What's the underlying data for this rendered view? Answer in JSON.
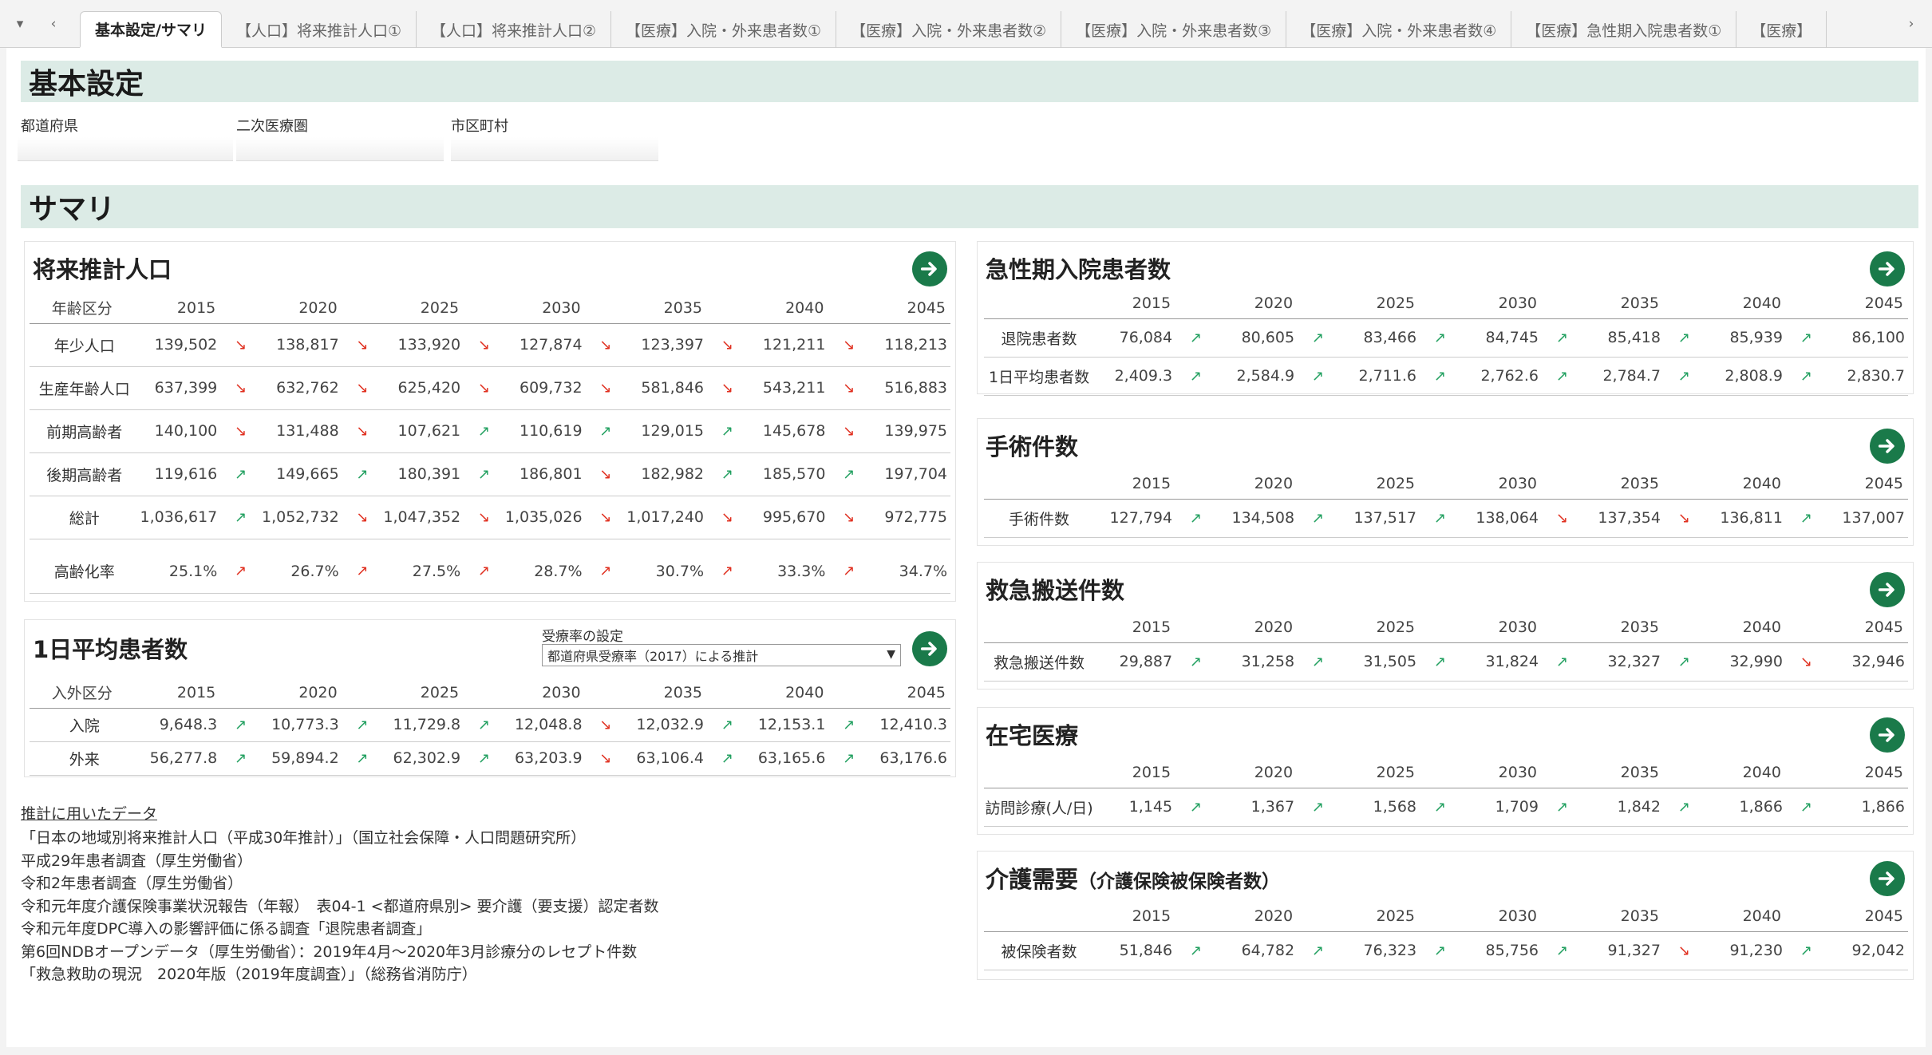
{
  "tabs": [
    "基本設定/サマリ",
    "【人口】将来推計人口①",
    "【人口】将来推計人口②",
    "【医療】入院・外来患者数①",
    "【医療】入院・外来患者数②",
    "【医療】入院・外来患者数③",
    "【医療】入院・外来患者数④",
    "【医療】急性期入院患者数①",
    "【医療】"
  ],
  "kihon": {
    "title": "基本設定",
    "prefecture_label": "都道府県",
    "area_label": "二次医療圏",
    "city_label": "市区町村"
  },
  "summary_title": "サマリ",
  "years": [
    "2015",
    "2020",
    "2025",
    "2030",
    "2035",
    "2040",
    "2045"
  ],
  "population": {
    "title": "将来推計人口",
    "header_label": "年齢区分",
    "rows": [
      {
        "label": "年少人口",
        "values": [
          "139,502",
          "138,817",
          "133,920",
          "127,874",
          "123,397",
          "121,211",
          "118,213"
        ],
        "trend": [
          "down",
          "down",
          "down",
          "down",
          "down",
          "down"
        ]
      },
      {
        "label": "生産年齢人口",
        "values": [
          "637,399",
          "632,762",
          "625,420",
          "609,732",
          "581,846",
          "543,211",
          "516,883"
        ],
        "trend": [
          "down",
          "down",
          "down",
          "down",
          "down",
          "down"
        ]
      },
      {
        "label": "前期高齢者",
        "values": [
          "140,100",
          "131,488",
          "107,621",
          "110,619",
          "129,015",
          "145,678",
          "139,975"
        ],
        "trend": [
          "down",
          "down",
          "up",
          "up",
          "up",
          "down"
        ]
      },
      {
        "label": "後期高齢者",
        "values": [
          "119,616",
          "149,665",
          "180,391",
          "186,801",
          "182,982",
          "185,570",
          "197,704"
        ],
        "trend": [
          "up",
          "up",
          "up",
          "down",
          "up",
          "up"
        ]
      },
      {
        "label": "総計",
        "values": [
          "1,036,617",
          "1,052,732",
          "1,047,352",
          "1,035,026",
          "1,017,240",
          "995,670",
          "972,775"
        ],
        "trend": [
          "up",
          "down",
          "down",
          "down",
          "down",
          "down"
        ]
      }
    ],
    "aging": {
      "label": "高齢化率",
      "values": [
        "25.1%",
        "26.7%",
        "27.5%",
        "28.7%",
        "30.7%",
        "33.3%",
        "34.7%"
      ],
      "trend": [
        "up",
        "up",
        "up",
        "up",
        "up",
        "up"
      ]
    }
  },
  "daily": {
    "title": "1日平均患者数",
    "header_label": "入外区分",
    "setting_label": "受療率の設定",
    "setting_value": "都道府県受療率（2017）による推計",
    "rows": [
      {
        "label": "入院",
        "values": [
          "9,648.3",
          "10,773.3",
          "11,729.8",
          "12,048.8",
          "12,032.9",
          "12,153.1",
          "12,410.3"
        ],
        "trend": [
          "up",
          "up",
          "up",
          "down",
          "up",
          "up"
        ]
      },
      {
        "label": "外来",
        "values": [
          "56,277.8",
          "59,894.2",
          "62,302.9",
          "63,203.9",
          "63,106.4",
          "63,165.6",
          "63,176.6"
        ],
        "trend": [
          "up",
          "up",
          "up",
          "down",
          "up",
          "up"
        ]
      }
    ]
  },
  "notes": {
    "title": "推計に用いたデータ",
    "lines": [
      "「日本の地域別将来推計人口（平成30年推計）」（国立社会保障・人口問題研究所）",
      "平成29年患者調査（厚生労働省）",
      "令和2年患者調査（厚生労働省）",
      "令和元年度介護保険事業状況報告（年報）　表04-1 <都道府県別> 要介護（要支援）認定者数",
      "令和元年度DPC導入の影響評価に係る調査「退院患者調査」",
      "第6回NDBオープンデータ（厚生労働省）：2019年4月～2020年3月診療分のレセプト件数",
      "「救急救助の現況　2020年版（2019年度調査）」（総務省消防庁）"
    ]
  },
  "acute": {
    "title": "急性期入院患者数",
    "rows": [
      {
        "label": "退院患者数",
        "values": [
          "76,084",
          "80,605",
          "83,466",
          "84,745",
          "85,418",
          "85,939",
          "86,100"
        ],
        "trend": [
          "up",
          "up",
          "up",
          "up",
          "up",
          "up"
        ]
      },
      {
        "label": "1日平均患者数",
        "values": [
          "2,409.3",
          "2,584.9",
          "2,711.6",
          "2,762.6",
          "2,784.7",
          "2,808.9",
          "2,830.7"
        ],
        "trend": [
          "up",
          "up",
          "up",
          "up",
          "up",
          "up"
        ]
      }
    ]
  },
  "surgery": {
    "title": "手術件数",
    "rows": [
      {
        "label": "手術件数",
        "values": [
          "127,794",
          "134,508",
          "137,517",
          "138,064",
          "137,354",
          "136,811",
          "137,007"
        ],
        "trend": [
          "up",
          "up",
          "up",
          "down",
          "down",
          "up"
        ]
      }
    ]
  },
  "emergency": {
    "title": "救急搬送件数",
    "rows": [
      {
        "label": "救急搬送件数",
        "values": [
          "29,887",
          "31,258",
          "31,505",
          "31,824",
          "32,327",
          "32,990",
          "32,946"
        ],
        "trend": [
          "up",
          "up",
          "up",
          "up",
          "up",
          "down"
        ]
      }
    ]
  },
  "homecare": {
    "title": "在宅医療",
    "rows": [
      {
        "label": "訪問診療(人/日)",
        "values": [
          "1,145",
          "1,367",
          "1,568",
          "1,709",
          "1,842",
          "1,866",
          "1,866"
        ],
        "trend": [
          "up",
          "up",
          "up",
          "up",
          "up",
          "up"
        ]
      }
    ]
  },
  "care": {
    "title": "介護需要",
    "subtitle": "（介護保険被保険者数）",
    "rows": [
      {
        "label": "被保険者数",
        "values": [
          "51,846",
          "64,782",
          "76,323",
          "85,756",
          "91,327",
          "91,230",
          "92,042"
        ],
        "trend": [
          "up",
          "up",
          "up",
          "up",
          "down",
          "up"
        ]
      }
    ]
  }
}
